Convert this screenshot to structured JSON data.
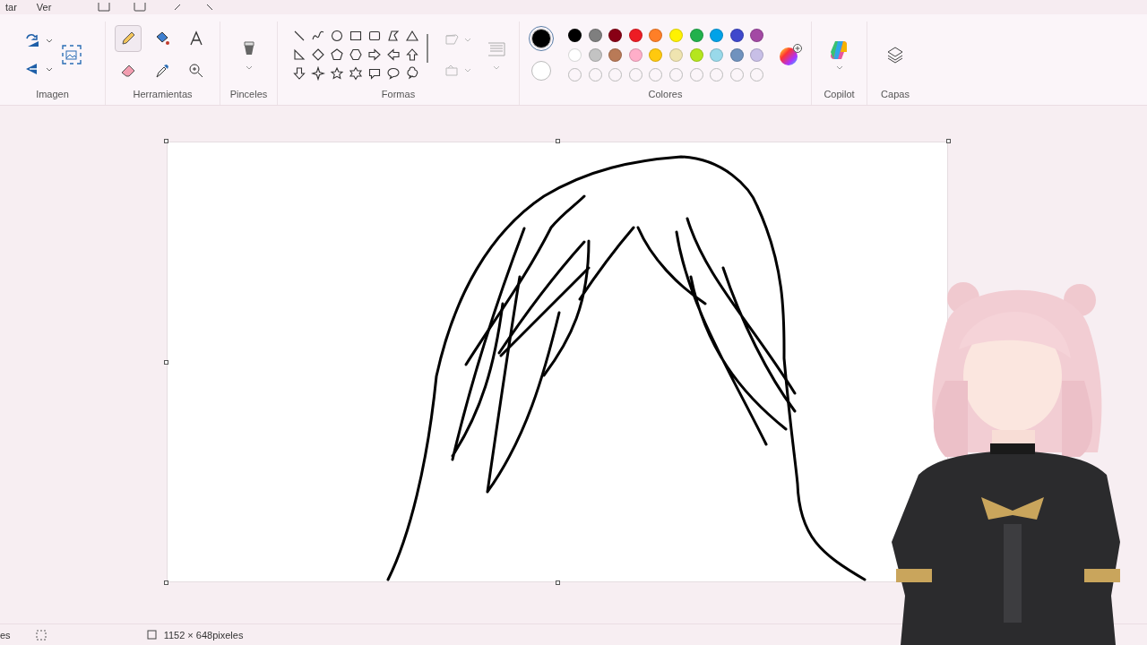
{
  "menu": [
    {
      "label": "tar"
    },
    {
      "label": "Ver"
    }
  ],
  "ribbon": {
    "groups": [
      {
        "label": "Imagen"
      },
      {
        "label": "Herramientas"
      },
      {
        "label": "Pinceles"
      },
      {
        "label": "Formas"
      },
      {
        "label": "Colores"
      },
      {
        "label": "Copilot"
      },
      {
        "label": "Capas"
      }
    ],
    "tools": [
      {
        "kind": "pencil",
        "selected": true
      },
      {
        "kind": "fill",
        "selected": false
      },
      {
        "kind": "text",
        "selected": false
      },
      {
        "kind": "eraser",
        "selected": false
      },
      {
        "kind": "picker",
        "selected": false
      },
      {
        "kind": "zoom",
        "selected": false
      }
    ],
    "current_colors": [
      {
        "color": "#000000",
        "selected": true
      },
      {
        "color": "#ffffff",
        "selected": false
      }
    ],
    "palette": [
      {
        "color": "#000000"
      },
      {
        "color": "#7f7f7f"
      },
      {
        "color": "#880015"
      },
      {
        "color": "#ed1c24"
      },
      {
        "color": "#ff7f27"
      },
      {
        "color": "#fff200"
      },
      {
        "color": "#22b14c"
      },
      {
        "color": "#00a2e8"
      },
      {
        "color": "#3f48cc"
      },
      {
        "color": "#a349a4"
      },
      {
        "color": "#ffffff"
      },
      {
        "color": "#c3c3c3"
      },
      {
        "color": "#b97a57"
      },
      {
        "color": "#ffaec9"
      },
      {
        "color": "#ffc90e"
      },
      {
        "color": "#efe4b0"
      },
      {
        "color": "#b5e61d"
      },
      {
        "color": "#99d9ea"
      },
      {
        "color": "#7092be"
      },
      {
        "color": "#c8bfe7"
      }
    ]
  },
  "status_bar": {
    "left": "es",
    "canvas_size": "1152 × 648pixeles"
  }
}
